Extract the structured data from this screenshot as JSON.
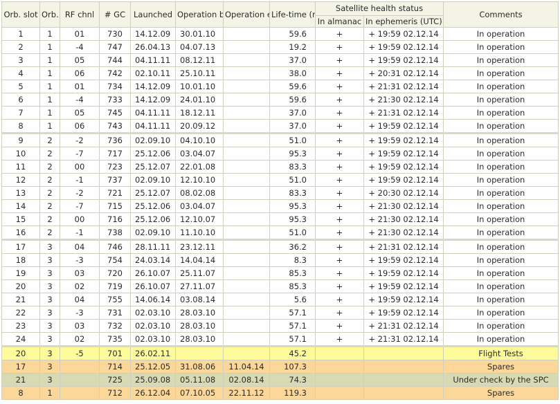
{
  "headers": {
    "slot": "Orb. slot",
    "plane": "Orb. pl.",
    "rf": "RF chnl",
    "gc": "# GC",
    "launched": "Launched",
    "begins": "Operation begins",
    "ends": "Operation ends",
    "life": "Life-time (months)",
    "health": "Satellite health status",
    "almanac": "In almanac",
    "ephemeris": "In ephemeris (UTC)",
    "comments": "Comments"
  },
  "rows": [
    {
      "slot": "1",
      "plane": "1",
      "rf": "01",
      "gc": "730",
      "launched": "14.12.09",
      "begins": "30.01.10",
      "ends": "",
      "life": "59.6",
      "almanac": "+",
      "ephemeris": "+ 19:59 02.12.14",
      "comment": "In operation"
    },
    {
      "slot": "2",
      "plane": "1",
      "rf": "-4",
      "gc": "747",
      "launched": "26.04.13",
      "begins": "04.07.13",
      "ends": "",
      "life": "19.2",
      "almanac": "+",
      "ephemeris": "+ 19:59 02.12.14",
      "comment": "In operation"
    },
    {
      "slot": "3",
      "plane": "1",
      "rf": "05",
      "gc": "744",
      "launched": "04.11.11",
      "begins": "08.12.11",
      "ends": "",
      "life": "37.0",
      "almanac": "+",
      "ephemeris": "+ 19:59 02.12.14",
      "comment": "In operation"
    },
    {
      "slot": "4",
      "plane": "1",
      "rf": "06",
      "gc": "742",
      "launched": "02.10.11",
      "begins": "25.10.11",
      "ends": "",
      "life": "38.0",
      "almanac": "+",
      "ephemeris": "+ 20:31 02.12.14",
      "comment": "In operation"
    },
    {
      "slot": "5",
      "plane": "1",
      "rf": "01",
      "gc": "734",
      "launched": "14.12.09",
      "begins": "10.01.10",
      "ends": "",
      "life": "59.6",
      "almanac": "+",
      "ephemeris": "+ 21:31 02.12.14",
      "comment": "In operation"
    },
    {
      "slot": "6",
      "plane": "1",
      "rf": "-4",
      "gc": "733",
      "launched": "14.12.09",
      "begins": "24.01.10",
      "ends": "",
      "life": "59.6",
      "almanac": "+",
      "ephemeris": "+ 21:30 02.12.14",
      "comment": "In operation"
    },
    {
      "slot": "7",
      "plane": "1",
      "rf": "05",
      "gc": "745",
      "launched": "04.11.11",
      "begins": "18.12.11",
      "ends": "",
      "life": "37.0",
      "almanac": "+",
      "ephemeris": "+ 21:31 02.12.14",
      "comment": "In operation"
    },
    {
      "slot": "8",
      "plane": "1",
      "rf": "06",
      "gc": "743",
      "launched": "04.11.11",
      "begins": "20.09.12",
      "ends": "",
      "life": "37.0",
      "almanac": "+",
      "ephemeris": "+ 19:59 02.12.14",
      "comment": "In operation"
    },
    {
      "slot": "9",
      "plane": "2",
      "rf": "-2",
      "gc": "736",
      "launched": "02.09.10",
      "begins": "04.10.10",
      "ends": "",
      "life": "51.0",
      "almanac": "+",
      "ephemeris": "+ 19:59 02.12.14",
      "comment": "In operation",
      "group_start": true
    },
    {
      "slot": "10",
      "plane": "2",
      "rf": "-7",
      "gc": "717",
      "launched": "25.12.06",
      "begins": "03.04.07",
      "ends": "",
      "life": "95.3",
      "almanac": "+",
      "ephemeris": "+ 19:59 02.12.14",
      "comment": "In operation"
    },
    {
      "slot": "11",
      "plane": "2",
      "rf": "00",
      "gc": "723",
      "launched": "25.12.07",
      "begins": "22.01.08",
      "ends": "",
      "life": "83.3",
      "almanac": "+",
      "ephemeris": "+ 19:59 02.12.14",
      "comment": "In operation"
    },
    {
      "slot": "12",
      "plane": "2",
      "rf": "-1",
      "gc": "737",
      "launched": "02.09.10",
      "begins": "12.10.10",
      "ends": "",
      "life": "51.0",
      "almanac": "+",
      "ephemeris": "+ 19:59 02.12.14",
      "comment": "In operation"
    },
    {
      "slot": "13",
      "plane": "2",
      "rf": "-2",
      "gc": "721",
      "launched": "25.12.07",
      "begins": "08.02.08",
      "ends": "",
      "life": "83.3",
      "almanac": "+",
      "ephemeris": "+ 20:30 02.12.14",
      "comment": "In operation"
    },
    {
      "slot": "14",
      "plane": "2",
      "rf": "-7",
      "gc": "715",
      "launched": "25.12.06",
      "begins": "03.04.07",
      "ends": "",
      "life": "95.3",
      "almanac": "+",
      "ephemeris": "+ 21:30 02.12.14",
      "comment": "In operation"
    },
    {
      "slot": "15",
      "plane": "2",
      "rf": "00",
      "gc": "716",
      "launched": "25.12.06",
      "begins": "12.10.07",
      "ends": "",
      "life": "95.3",
      "almanac": "+",
      "ephemeris": "+ 21:30 02.12.14",
      "comment": "In operation"
    },
    {
      "slot": "16",
      "plane": "2",
      "rf": "-1",
      "gc": "738",
      "launched": "02.09.10",
      "begins": "11.10.10",
      "ends": "",
      "life": "51.0",
      "almanac": "+",
      "ephemeris": "+ 21:30 02.12.14",
      "comment": "In operation"
    },
    {
      "slot": "17",
      "plane": "3",
      "rf": "04",
      "gc": "746",
      "launched": "28.11.11",
      "begins": "23.12.11",
      "ends": "",
      "life": "36.2",
      "almanac": "+",
      "ephemeris": "+ 21:31 02.12.14",
      "comment": "In operation",
      "group_start": true
    },
    {
      "slot": "18",
      "plane": "3",
      "rf": "-3",
      "gc": "754",
      "launched": "24.03.14",
      "begins": "14.04.14",
      "ends": "",
      "life": "8.3",
      "almanac": "+",
      "ephemeris": "+ 19:59 02.12.14",
      "comment": "In operation"
    },
    {
      "slot": "19",
      "plane": "3",
      "rf": "03",
      "gc": "720",
      "launched": "26.10.07",
      "begins": "25.11.07",
      "ends": "",
      "life": "85.3",
      "almanac": "+",
      "ephemeris": "+ 19:59 02.12.14",
      "comment": "In operation"
    },
    {
      "slot": "20",
      "plane": "3",
      "rf": "02",
      "gc": "719",
      "launched": "26.10.07",
      "begins": "27.11.07",
      "ends": "",
      "life": "85.3",
      "almanac": "+",
      "ephemeris": "+ 19:59 02.12.14",
      "comment": "In operation"
    },
    {
      "slot": "21",
      "plane": "3",
      "rf": "04",
      "gc": "755",
      "launched": "14.06.14",
      "begins": "03.08.14",
      "ends": "",
      "life": "5.6",
      "almanac": "+",
      "ephemeris": "+ 19:59 02.12.14",
      "comment": "In operation"
    },
    {
      "slot": "22",
      "plane": "3",
      "rf": "-3",
      "gc": "731",
      "launched": "02.03.10",
      "begins": "28.03.10",
      "ends": "",
      "life": "57.1",
      "almanac": "+",
      "ephemeris": "+ 19:59 02.12.14",
      "comment": "In operation"
    },
    {
      "slot": "23",
      "plane": "3",
      "rf": "03",
      "gc": "732",
      "launched": "02.03.10",
      "begins": "28.03.10",
      "ends": "",
      "life": "57.1",
      "almanac": "+",
      "ephemeris": "+ 21:31 02.12.14",
      "comment": "In operation"
    },
    {
      "slot": "24",
      "plane": "3",
      "rf": "02",
      "gc": "735",
      "launched": "02.03.10",
      "begins": "28.03.10",
      "ends": "",
      "life": "57.1",
      "almanac": "+",
      "ephemeris": "+ 21:31 02.12.14",
      "comment": "In operation"
    },
    {
      "slot": "20",
      "plane": "3",
      "rf": "-5",
      "gc": "701",
      "launched": "26.02.11",
      "begins": "",
      "ends": "",
      "life": "45.2",
      "almanac": "",
      "ephemeris": "",
      "comment": "Flight Tests",
      "status": "flight",
      "group_start": true
    },
    {
      "slot": "17",
      "plane": "3",
      "rf": "",
      "gc": "714",
      "launched": "25.12.05",
      "begins": "31.08.06",
      "ends": "11.04.14",
      "life": "107.3",
      "almanac": "",
      "ephemeris": "",
      "comment": "Spares",
      "status": "spare"
    },
    {
      "slot": "21",
      "plane": "3",
      "rf": "",
      "gc": "725",
      "launched": "25.09.08",
      "begins": "05.11.08",
      "ends": "02.08.14",
      "life": "74.3",
      "almanac": "",
      "ephemeris": "",
      "comment": "Under check by the SPC",
      "status": "check"
    },
    {
      "slot": "8",
      "plane": "1",
      "rf": "",
      "gc": "712",
      "launched": "26.12.04",
      "begins": "07.10.05",
      "ends": "22.11.12",
      "life": "119.3",
      "almanac": "",
      "ephemeris": "",
      "comment": "Spares",
      "status": "spare"
    }
  ],
  "colors": {
    "header_bg": "#f3f3e6",
    "grid": "#cfcfbd",
    "flight_tests": "#fdfb9a",
    "spares": "#fbd79a",
    "under_check": "#d7dbb3"
  }
}
